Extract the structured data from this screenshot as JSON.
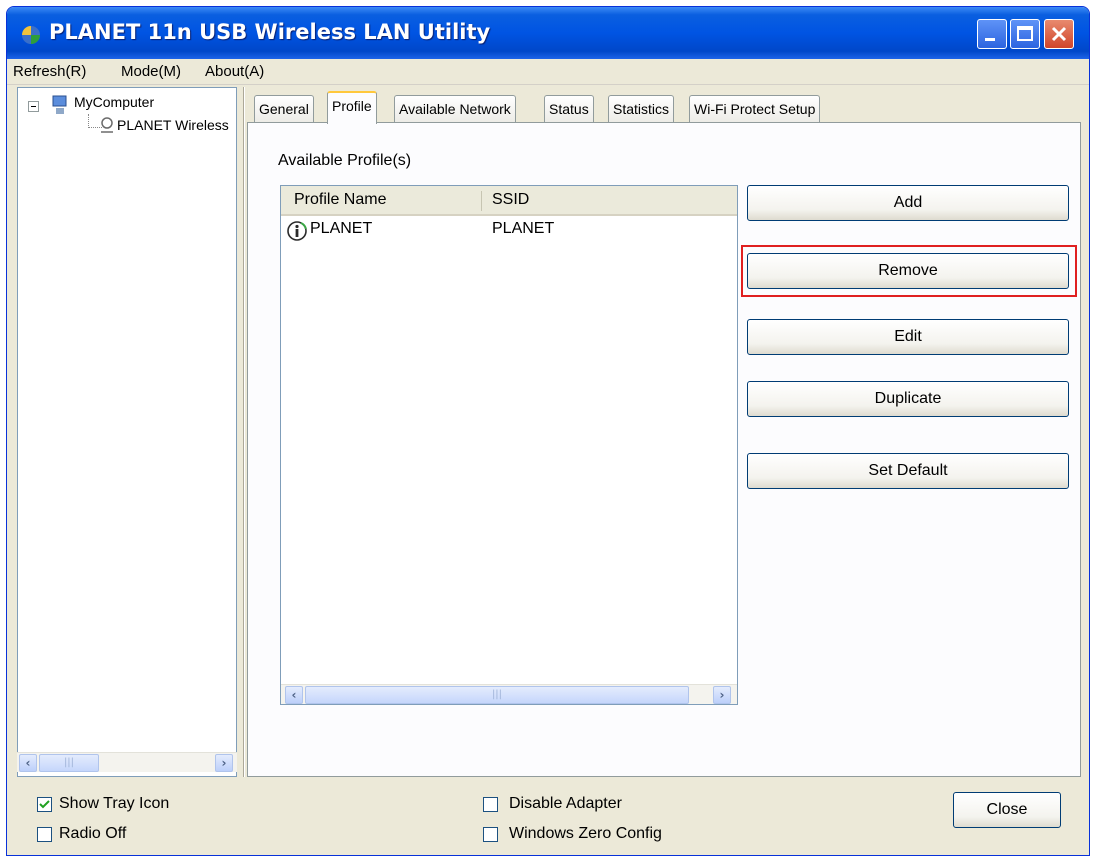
{
  "window": {
    "title": "PLANET 11n USB Wireless LAN Utility"
  },
  "menubar": {
    "items": [
      "Refresh(R)",
      "Mode(M)",
      "About(A)"
    ]
  },
  "tree": {
    "root": "MyComputer",
    "child": "PLANET Wireless"
  },
  "tabs": [
    {
      "label": "General",
      "active": false
    },
    {
      "label": "Profile",
      "active": true
    },
    {
      "label": "Available Network",
      "active": false
    },
    {
      "label": "Status",
      "active": false
    },
    {
      "label": "Statistics",
      "active": false
    },
    {
      "label": "Wi-Fi Protect Setup",
      "active": false
    }
  ],
  "profile": {
    "section_label": "Available Profile(s)",
    "columns": [
      "Profile Name",
      "SSID"
    ],
    "rows": [
      {
        "profile_name": "PLANET",
        "ssid": "PLANET",
        "icon": "info-icon"
      }
    ],
    "buttons": {
      "add": "Add",
      "remove": "Remove",
      "edit": "Edit",
      "duplicate": "Duplicate",
      "set_default": "Set Default"
    }
  },
  "footer": {
    "show_tray_icon": {
      "label": "Show Tray Icon",
      "checked": true
    },
    "radio_off": {
      "label": "Radio Off",
      "checked": false
    },
    "disable_adapter": {
      "label": "Disable Adapter",
      "checked": false
    },
    "windows_zero_config": {
      "label": "Windows Zero Config",
      "checked": false
    },
    "close": "Close"
  },
  "colors": {
    "highlight": "#e02020",
    "titlebar": "#0054e3"
  }
}
